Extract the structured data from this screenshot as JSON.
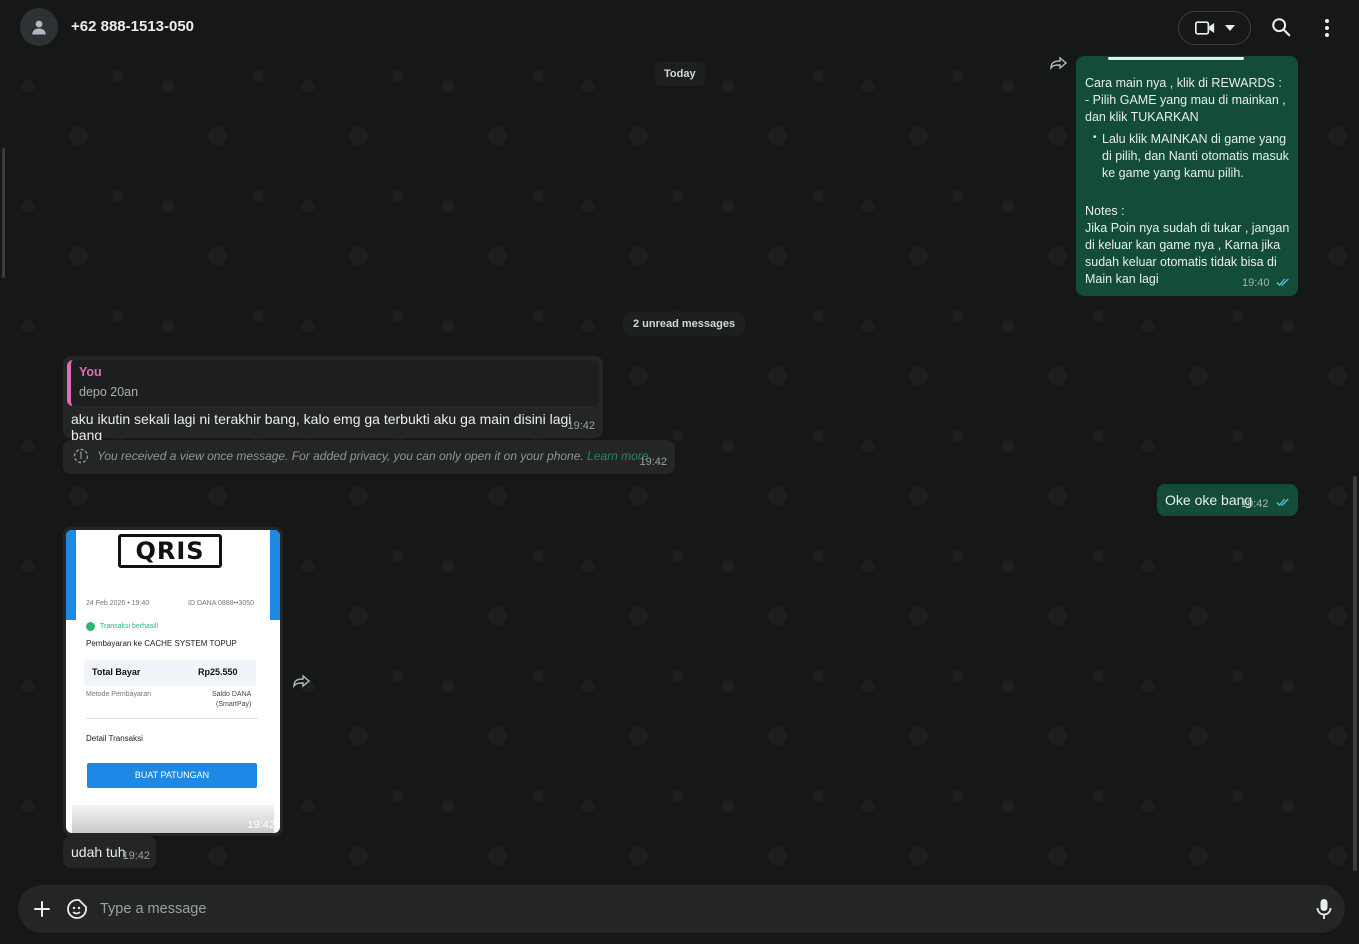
{
  "header": {
    "contact_name": "+62 888-1513-050"
  },
  "chat": {
    "date_separator": "Today",
    "unread_separator": "2 unread messages",
    "messages": [
      {
        "direction": "out",
        "lines_p1": "Cara main nya , klik di REWARDS :\n - Pilih  GAME yang mau di mainkan , dan klik TUKARKAN",
        "bullet": "Lalu klik MAINKAN di game yang di pilih, dan Nanti otomatis masuk ke game yang kamu pilih.",
        "lines_p2": "Notes :\nJika Poin nya sudah di tukar , jangan di keluar kan game nya , Karna jika sudah keluar otomatis tidak bisa di Main kan lagi",
        "time": "19:40"
      },
      {
        "direction": "in",
        "quote_author": "You",
        "quote_text": "depo 20an",
        "text": "aku ikutin sekali lagi ni terakhir bang, kalo emg ga terbukti aku ga main disini lagi bang",
        "time": "19:42"
      },
      {
        "direction": "in",
        "text": "You received a view once message. For added privacy, you can only open it on your phone.",
        "link": "Learn more",
        "time": "19:42"
      },
      {
        "direction": "out",
        "text": "Oke oke bang",
        "time": "19:42"
      },
      {
        "direction": "in",
        "type": "image",
        "receipt": {
          "logo": "QRIS",
          "date": "24 Feb 2026 • 19:40",
          "id": "ID DANA 0888••3050",
          "status": "Transaksi berhasil!",
          "merchant": "Pembayaran ke CACHE SYSTEM TOPUP",
          "total_label": "Total Bayar",
          "total_value": "Rp25.550",
          "method_label": "Metode Pembayaran",
          "method_value_1": "Saldo DANA",
          "method_value_2": "(SmartPay)",
          "detail_label": "Detail Transaksi",
          "button": "BUAT PATUNGAN"
        },
        "time": "19:42"
      },
      {
        "direction": "in",
        "text": "udah tuh",
        "time": "19:42"
      }
    ]
  },
  "composer": {
    "placeholder": "Type a message"
  },
  "colors": {
    "outgoing_bubble": "#144d37",
    "incoming_bubble": "#242626",
    "background": "#161717",
    "quote_accent": "#e26ab6",
    "read_tick": "#53bdeb"
  },
  "icons": [
    "person-icon",
    "video-icon",
    "chevron-down-icon",
    "search-icon",
    "menu-dots-icon",
    "forward-icon",
    "double-check-icon",
    "view-once-icon",
    "plus-icon",
    "sticker-icon",
    "mic-icon"
  ]
}
